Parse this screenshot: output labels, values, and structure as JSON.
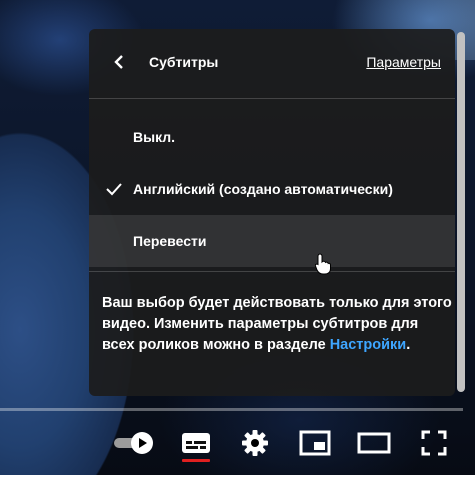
{
  "menu": {
    "title": "Субтитры",
    "settings_link": "Параметры",
    "options": [
      {
        "label": "Выкл.",
        "selected": false
      },
      {
        "label": "Английский (создано автоматически)",
        "selected": true
      },
      {
        "label": "Перевести",
        "selected": false,
        "hovered": true
      }
    ],
    "note_text": "Ваш выбор будет действовать только для этого видео. Изменить параметры субтитров для всех роликов можно в разделе ",
    "note_link": "Настройки",
    "note_end": "."
  },
  "controls": {
    "icons": [
      "autoplay-toggle-icon",
      "subtitles-icon",
      "gear-icon",
      "miniplayer-icon",
      "theater-mode-icon",
      "fullscreen-icon"
    ],
    "subtitles_active": true,
    "accent": "#e02020"
  },
  "colors": {
    "menu_bg": "#1c1c1c",
    "link": "#3ea6ff"
  }
}
